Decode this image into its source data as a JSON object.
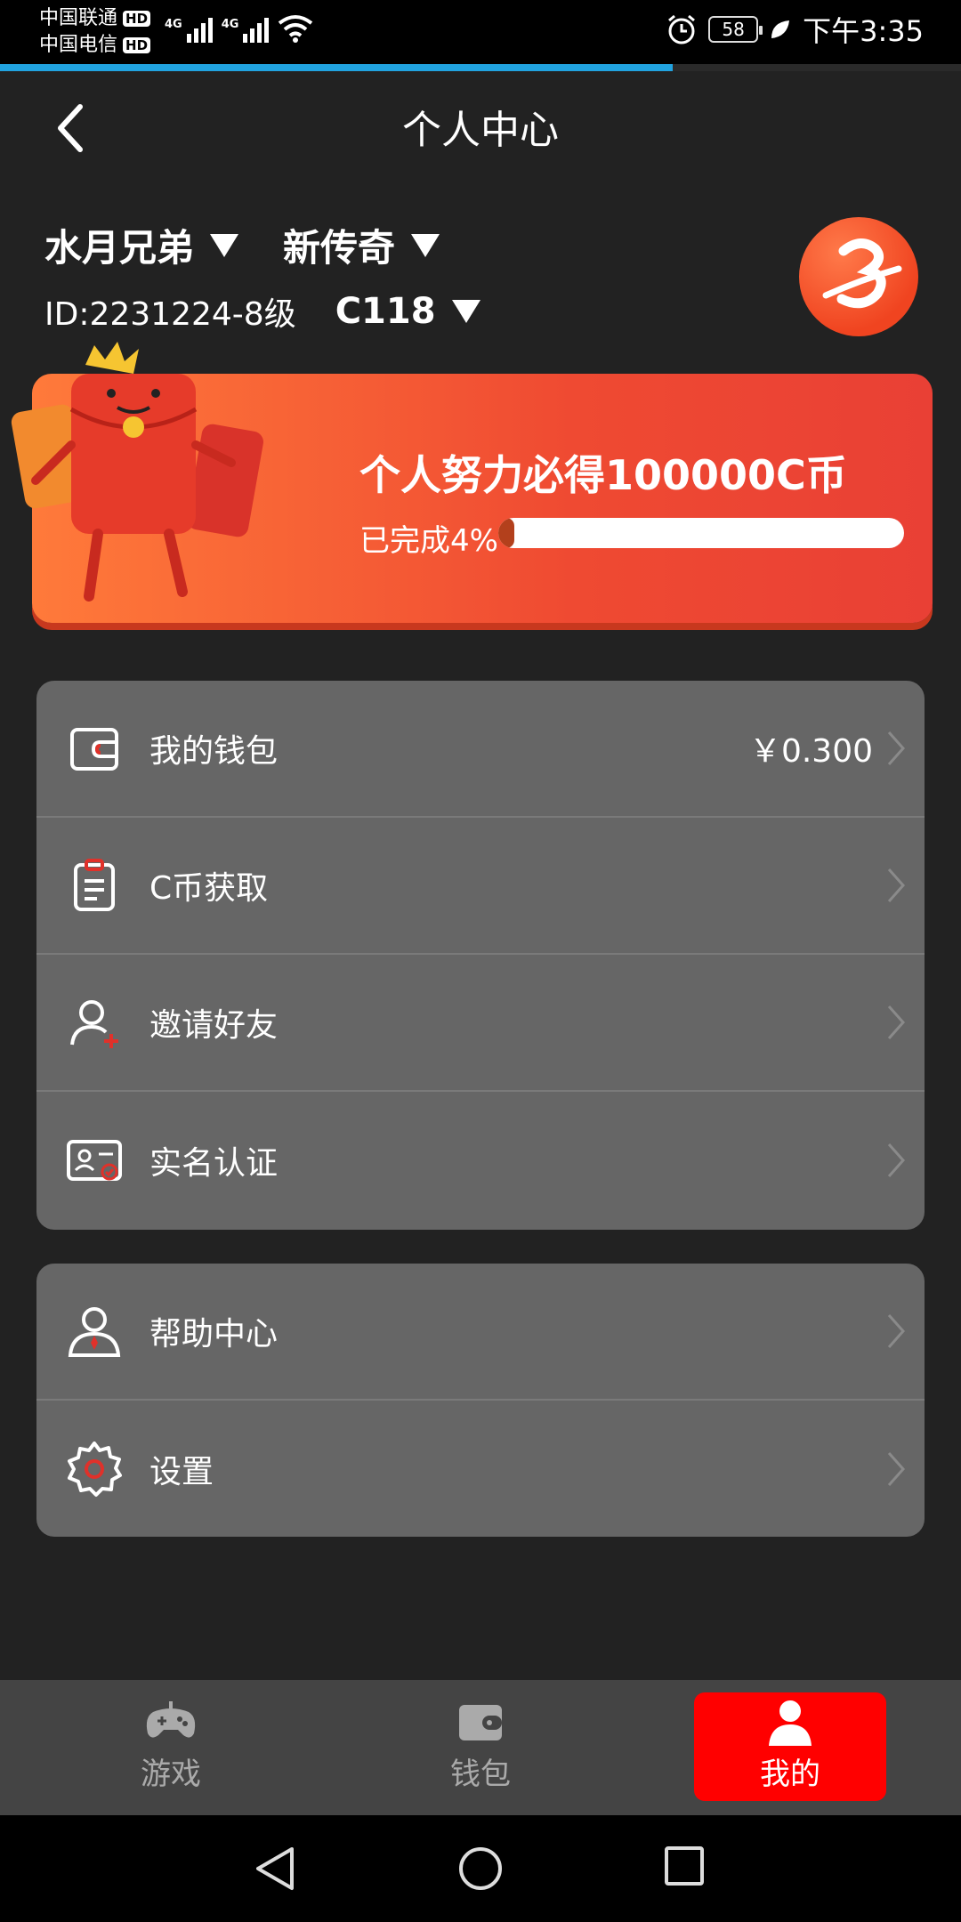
{
  "status_bar": {
    "carrier_1": "中国联通",
    "carrier_2": "中国电信",
    "hd_badge": "HD",
    "network_1": "4G",
    "network_2": "4G",
    "battery": "58",
    "time": "下午3:35"
  },
  "page_load_progress": 0.7,
  "header": {
    "title": "个人中心"
  },
  "profile": {
    "name": "水月兄弟",
    "server": "新传奇",
    "id": "ID:2231224-8级",
    "character": "C118"
  },
  "banner": {
    "title": "个人努力必得100000C币",
    "completed_label": "已完成4%",
    "progress": 0.04
  },
  "menu_main": [
    {
      "label": "我的钱包",
      "value": "￥0.300",
      "icon": "wallet-icon"
    },
    {
      "label": "C币获取",
      "value": "",
      "icon": "clipboard-icon"
    },
    {
      "label": "邀请好友",
      "value": "",
      "icon": "add-user-icon"
    },
    {
      "label": "实名认证",
      "value": "",
      "icon": "id-card-icon"
    }
  ],
  "menu_secondary": [
    {
      "label": "帮助中心",
      "icon": "help-user-icon"
    },
    {
      "label": "设置",
      "icon": "gear-icon"
    }
  ],
  "tabbar": {
    "tabs": [
      {
        "label": "游戏",
        "icon": "gamepad-icon"
      },
      {
        "label": "钱包",
        "icon": "wallet-icon"
      },
      {
        "label": "我的",
        "icon": "person-icon",
        "active": true
      }
    ]
  },
  "colors": {
    "accent_red": "#ff0000",
    "banner_orange": "#ef4a32",
    "card_gray": "#666666",
    "background": "#222222"
  }
}
